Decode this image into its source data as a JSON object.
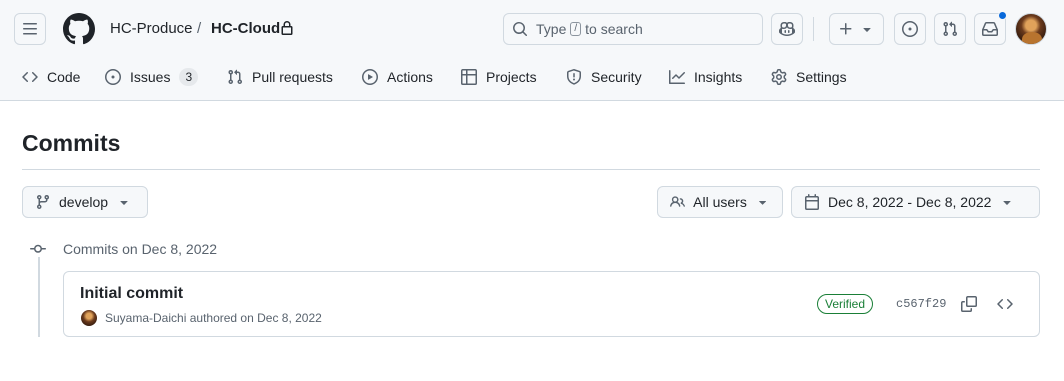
{
  "repo": {
    "owner": "HC-Produce",
    "separator": "/",
    "name": "HC-Cloud"
  },
  "search": {
    "prefix": "Type",
    "key": "/",
    "suffix": "to search"
  },
  "tabs": [
    {
      "label": "Code"
    },
    {
      "label": "Issues",
      "count": "3"
    },
    {
      "label": "Pull requests"
    },
    {
      "label": "Actions"
    },
    {
      "label": "Projects"
    },
    {
      "label": "Security"
    },
    {
      "label": "Insights"
    },
    {
      "label": "Settings"
    }
  ],
  "page": {
    "title": "Commits"
  },
  "filters": {
    "branch": "develop",
    "users": "All users",
    "date_range": "Dec 8, 2022 - Dec 8, 2022"
  },
  "commit_group": {
    "label": "Commits on Dec 8, 2022",
    "commits": [
      {
        "title": "Initial commit",
        "author": "Suyama-Daichi",
        "action": "authored on Dec 8, 2022",
        "badge": "Verified",
        "sha": "c567f29"
      }
    ]
  },
  "colors": {
    "accent": "#0969da",
    "verified": "#1a7f37",
    "header_bg": "#f6f8fa",
    "border": "#d1d9e0"
  }
}
